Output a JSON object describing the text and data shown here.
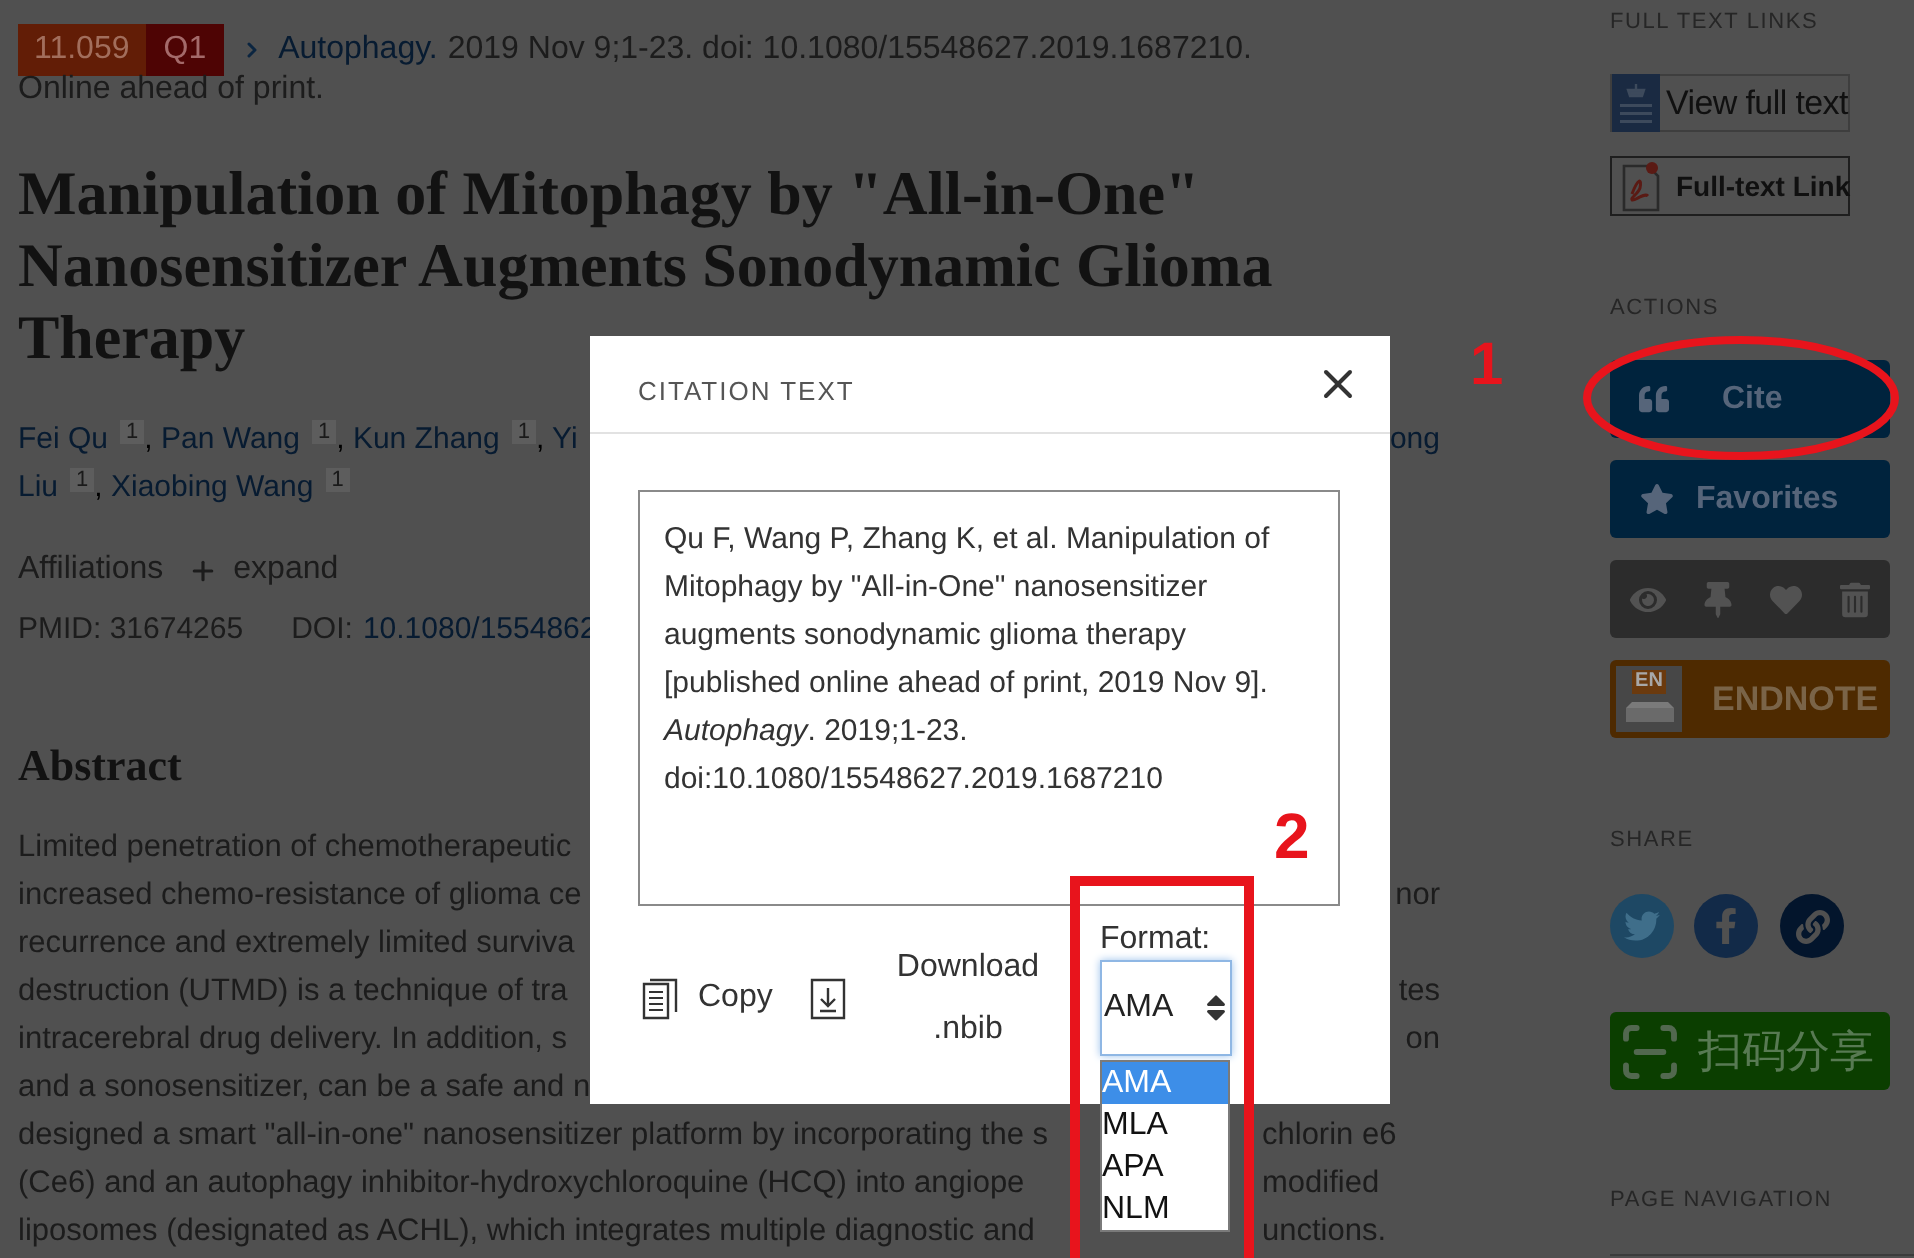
{
  "journal_line": {
    "impact_factor": "11.059",
    "quartile": "Q1",
    "journal": "Autophagy.",
    "details": "2019 Nov 9;1-23. doi: 10.1080/15548627.2019.1687210.",
    "status": "Online ahead of print."
  },
  "title": "Manipulation of Mitophagy by \"All-in-One\" Nanosensitizer Augments Sonodynamic Glioma Therapy",
  "author_lines": [
    {
      "left": [
        {
          "name": "Fei Qu",
          "sup": "1",
          "sep": ","
        },
        {
          "name": "Pan Wang",
          "sup": "1",
          "sep": ","
        },
        {
          "name": "Kun Zhang",
          "sup": "1",
          "sep": ","
        },
        {
          "name": "Yi"
        }
      ],
      "right": [
        {
          "name": "ong"
        }
      ]
    },
    {
      "left": [
        {
          "name": "Liu",
          "sup": "1",
          "sep": ","
        },
        {
          "name": "Xiaobing Wang",
          "sup": "1"
        }
      ]
    }
  ],
  "affiliations": {
    "label": "Affiliations",
    "toggle": "expand",
    "expanded": false
  },
  "identifiers": {
    "pmid_label": "PMID:",
    "pmid": "31674265",
    "doi_label": "DOI:",
    "doi": "10.1080/1554862"
  },
  "abstract": {
    "heading": "Abstract",
    "upper_lines": [
      {
        "left": "Limited penetration of chemotherapeutic"
      },
      {
        "left": "increased chemo-resistance of glioma ce",
        "right": "nor"
      },
      {
        "left": "recurrence and extremely limited surviva"
      },
      {
        "left": "destruction (UTMD) is a technique of tra",
        "right": "tes"
      },
      {
        "left": "intracerebral drug delivery. In addition, s",
        "right": "on"
      },
      {
        "left": "and a sonosensitizer, can be a safe and n"
      }
    ],
    "lower_lines": [
      {
        "left": "designed a smart \"all-in-one\" nanosensitizer platform by incorporating the s",
        "right": "chlorin e6"
      },
      {
        "left": "(Ce6) and an autophagy inhibitor-hydroxychloroquine (HCQ) into angiope",
        "right": "modified"
      },
      {
        "left": "liposomes (designated as ACHL), which integrates multiple diagnostic and",
        "right": "unctions."
      }
    ]
  },
  "sidebar": {
    "full_text_heading": "FULL TEXT LINKS",
    "full_text_links": [
      {
        "kind": "publisher",
        "label": "View full text"
      },
      {
        "kind": "pdf",
        "label": "Full-text Link"
      }
    ],
    "actions_heading": "ACTIONS",
    "actions": [
      {
        "kind": "cite",
        "label": "Cite"
      },
      {
        "kind": "favorites",
        "label": "Favorites"
      }
    ],
    "endnote": {
      "logo": "EN",
      "label": "ENDNOTE"
    },
    "share_heading": "SHARE",
    "qr_share": "扫码分享",
    "page_navigation_heading": "PAGE NAVIGATION"
  },
  "citation_dialog": {
    "title": "CITATION TEXT",
    "citation": "Qu F, Wang P, Zhang K, et al. Manipulation of Mitophagy by \"All-in-One\" nanosensitizer augments sonodynamic glioma therapy [published online ahead of print, 2019 Nov 9]. *Autophagy*. 2019;1-23. doi:10.1080/15548627.2019.1687210",
    "copy": "Copy",
    "download": "Download .nbib",
    "format_label": "Format:",
    "format_value": "AMA",
    "format_options": [
      {
        "label": "AMA",
        "selected": true
      },
      {
        "label": "MLA",
        "selected": false
      },
      {
        "label": "APA",
        "selected": false
      },
      {
        "label": "NLM",
        "selected": false
      }
    ]
  },
  "annotations": [
    {
      "kind": "ellipse",
      "label": "1"
    },
    {
      "kind": "rectangle",
      "label": "2"
    }
  ]
}
